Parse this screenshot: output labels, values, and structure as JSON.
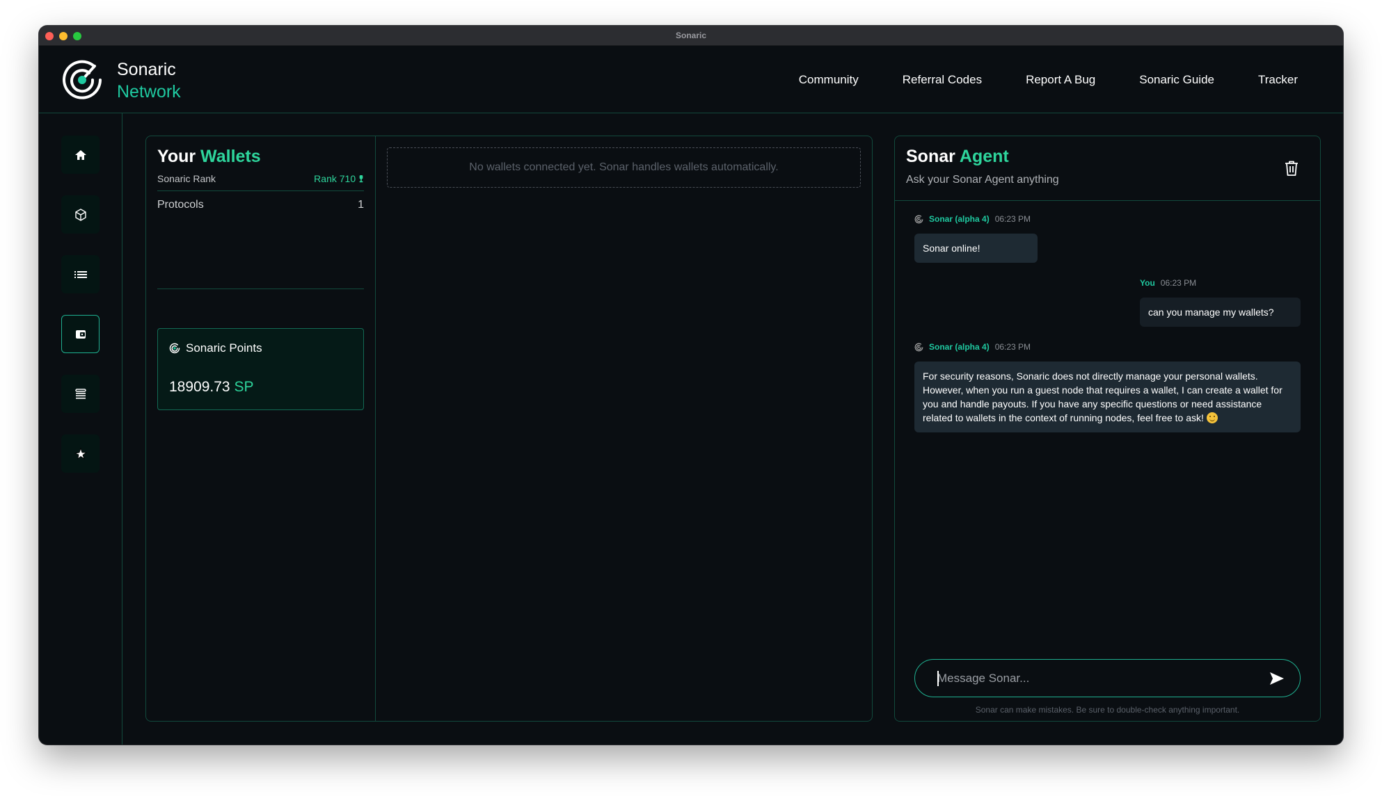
{
  "window": {
    "title": "Sonaric"
  },
  "header": {
    "logo": {
      "line1": "Sonaric",
      "line2": "Network",
      "icon": "sonaric-radar-icon"
    },
    "nav": [
      {
        "label": "Community"
      },
      {
        "label": "Referral Codes"
      },
      {
        "label": "Report A Bug"
      },
      {
        "label": "Sonaric Guide"
      },
      {
        "label": "Tracker"
      }
    ]
  },
  "sidebar": {
    "items": [
      {
        "name": "home",
        "icon": "home-icon",
        "active": false
      },
      {
        "name": "nodes",
        "icon": "cube-icon",
        "active": false
      },
      {
        "name": "list",
        "icon": "list-icon",
        "active": false
      },
      {
        "name": "wallets",
        "icon": "wallet-icon",
        "active": true
      },
      {
        "name": "storage",
        "icon": "server-stack-icon",
        "active": false
      },
      {
        "name": "extras",
        "icon": "star-burst-icon",
        "active": false
      }
    ]
  },
  "wallets": {
    "title_prefix": "Your",
    "title_accent": "Wallets",
    "rank_label": "Sonaric Rank",
    "rank_value": "Rank 710",
    "rank_icon": "medal-icon",
    "protocols_label": "Protocols",
    "protocols_value": "1",
    "points": {
      "label": "Sonaric Points",
      "value": "18909.73",
      "unit": "SP"
    },
    "empty_message": "No wallets connected yet. Sonar handles wallets automatically."
  },
  "chat": {
    "title_prefix": "Sonar",
    "title_accent": "Agent",
    "subtitle": "Ask your Sonar Agent anything",
    "messages": [
      {
        "sender": "Sonar (alpha 4)",
        "time": "06:23 PM",
        "role": "bot",
        "text": "Sonar online!"
      },
      {
        "sender": "You",
        "time": "06:23 PM",
        "role": "user",
        "text": "can you manage my wallets?"
      },
      {
        "sender": "Sonar (alpha 4)",
        "time": "06:23 PM",
        "role": "bot",
        "text": "For security reasons, Sonaric does not directly manage your personal wallets. However, when you run a guest node that requires a wallet, I can create a wallet for you and handle payouts. If you have any specific questions or need assistance related to wallets in the context of running nodes, feel free to ask!"
      }
    ],
    "input": {
      "value": "",
      "placeholder": "Message Sonar..."
    },
    "disclaimer": "Sonar can make mistakes. Be sure to double-check anything important."
  },
  "colors": {
    "accent": "#2ed59c",
    "accent_teal": "#1fc9a0",
    "border": "#124a3d",
    "background": "#0a0e12"
  }
}
